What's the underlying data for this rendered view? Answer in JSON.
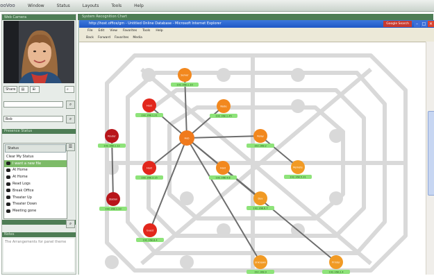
{
  "menubar": {
    "logo": "ooVoo",
    "items": [
      "Window",
      "Status",
      "Layouts",
      "Tools",
      "Help"
    ]
  },
  "left": {
    "video_title": "Web Camera",
    "controls": {
      "share": "Share",
      "sq": "▤"
    },
    "field1": "",
    "field2": "Bob",
    "status_header": "Presence Status",
    "status_select": "Status",
    "status_items": [
      "Clear My Status",
      "I want a new file",
      "At Home",
      "At Home",
      "Read Logs",
      "Break Office",
      "Theater Up",
      "Theater Down",
      "Meeting gone"
    ],
    "notes_header": "Notes",
    "notes_text": "The Arrangements for panel theme"
  },
  "window": {
    "title": "System Recognition Chart"
  },
  "browser": {
    "title": "http://host.office/gm - Untitled Online Database - Microsoft Internet Explorer",
    "tabfx": "Google Search",
    "menu": [
      "File",
      "Edit",
      "View",
      "Favorites",
      "Tools",
      "Help"
    ],
    "toolbar": [
      "Back",
      "Forward",
      "Favorites",
      "Media"
    ]
  },
  "graph": {
    "colors": {
      "hub": "#f07a1c",
      "red": "#e2271c",
      "dark_red": "#b8151a",
      "orange": "#f2881e",
      "amber": "#f19a24",
      "label": "#8ee37a",
      "ghost": "#d9d9d9"
    },
    "nodes": [
      {
        "id": "n1",
        "label": "Server",
        "tag": "192.168.1.10",
        "color": "orange"
      },
      {
        "id": "n2",
        "label": "Host",
        "tag": "192.168.1.21",
        "color": "red"
      },
      {
        "id": "n3",
        "label": "Node",
        "tag": "192.168.1.45",
        "color": "orange"
      },
      {
        "id": "n4",
        "label": "Router",
        "tag": "192.168.1.12",
        "color": "dark_red"
      },
      {
        "id": "hub",
        "label": "Hub",
        "tag": "",
        "color": "hub"
      },
      {
        "id": "n5",
        "label": "Relay",
        "tag": "192.168.2",
        "color": "orange"
      },
      {
        "id": "n6",
        "label": "Host",
        "tag": "192.168.3.15",
        "color": "red"
      },
      {
        "id": "n7",
        "label": "Host",
        "tag": "192.168.4.8",
        "color": "orange"
      },
      {
        "id": "n8",
        "label": "Remote",
        "tag": "192.168.5.31",
        "color": "amber"
      },
      {
        "id": "n9",
        "label": "Station",
        "tag": "192.168.1.33",
        "color": "dark_red"
      },
      {
        "id": "n10",
        "label": "Dev",
        "tag": "192.168.6.7",
        "color": "amber"
      },
      {
        "id": "n11",
        "label": "Guest",
        "tag": "192.168.8.4",
        "color": "red"
      },
      {
        "id": "n12",
        "label": "Unknown",
        "tag": "192.168.9",
        "color": "amber"
      },
      {
        "id": "n13",
        "label": "Printer",
        "tag": "192.168.2.4",
        "color": "amber"
      }
    ]
  }
}
